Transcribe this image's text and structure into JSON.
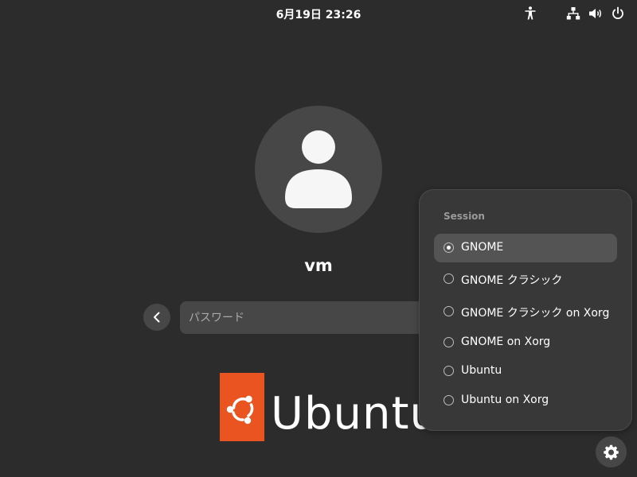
{
  "topbar": {
    "datetime": "6月19日  23:26",
    "icons": [
      "accessibility-icon",
      "network-icon",
      "volume-icon",
      "power-icon"
    ]
  },
  "login": {
    "avatar_icon": "user-avatar-icon",
    "username": "vm",
    "back_icon": "chevron-left-icon",
    "password_placeholder": "パスワード",
    "password_value": ""
  },
  "logo": {
    "text": "Ubuntu",
    "color": "#e95420"
  },
  "session_menu": {
    "heading": "Session",
    "items": [
      {
        "label": "GNOME",
        "selected": true
      },
      {
        "label": "GNOME クラシック",
        "selected": false
      },
      {
        "label": "GNOME クラシック on Xorg",
        "selected": false
      },
      {
        "label": "GNOME on Xorg",
        "selected": false
      },
      {
        "label": "Ubuntu",
        "selected": false
      },
      {
        "label": "Ubuntu on Xorg",
        "selected": false
      }
    ]
  },
  "settings": {
    "icon": "gear-icon"
  },
  "colors": {
    "background": "#2c2c2c",
    "surface": "#474747",
    "menu_background": "#383838",
    "selected_item": "#545454",
    "accent": "#e95420"
  }
}
